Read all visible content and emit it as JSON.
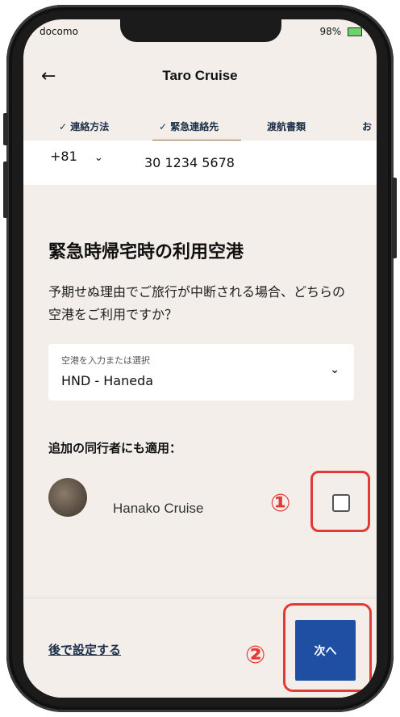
{
  "status": {
    "carrier": "docomo",
    "battery": "98%"
  },
  "header": {
    "back_icon": "arrow-left-icon",
    "title": "Taro Cruise"
  },
  "tabs": [
    {
      "label": "✓ 連絡方法"
    },
    {
      "label": "✓ 緊急連絡先"
    },
    {
      "label": "渡航書類"
    },
    {
      "label": "お"
    }
  ],
  "phone": {
    "country_code": "+81",
    "number": "30 1234 5678"
  },
  "section": {
    "title": "緊急時帰宅時の利用空港",
    "description": "予期せぬ理由でご旅行が中断される場合、どちらの空港をご利用ですか？"
  },
  "airport": {
    "label": "空港を入力または選択",
    "value": "HND - Haneda"
  },
  "companions": {
    "title": "追加の同行者にも適用：",
    "name": "Hanako Cruise"
  },
  "annotations": {
    "one": "①",
    "two": "②"
  },
  "footer": {
    "later_label": "後で設定する",
    "next_label": "次へ"
  }
}
